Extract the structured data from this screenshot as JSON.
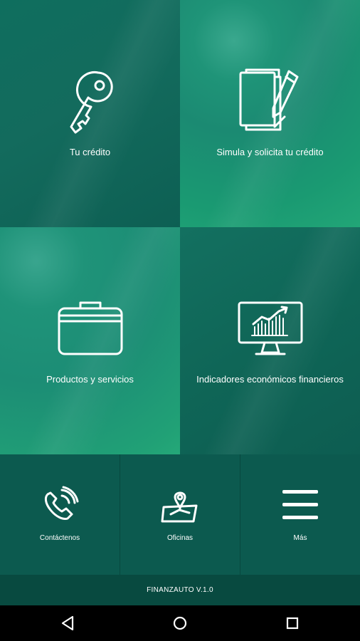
{
  "tiles": {
    "credit": {
      "label": "Tu crédito",
      "icon": "key-icon"
    },
    "simulate": {
      "label": "Simula y solicita tu crédito",
      "icon": "documents-pencil-icon"
    },
    "products": {
      "label": "Productos y servicios",
      "icon": "briefcase-icon"
    },
    "indicators": {
      "label": "Indicadores económicos financieros",
      "icon": "monitor-chart-icon"
    }
  },
  "shortcuts": {
    "contact": {
      "label": "Contáctenos",
      "icon": "phone-icon"
    },
    "offices": {
      "label": "Oficinas",
      "icon": "map-pin-icon"
    },
    "more": {
      "label": "Más",
      "icon": "menu-icon"
    }
  },
  "footer": {
    "version": "FINANZAUTO V.1.0"
  },
  "navbar": {
    "back": "back-icon",
    "home": "home-icon",
    "recents": "recents-icon"
  },
  "colors": {
    "primary_dark": "#0c5a4f",
    "primary": "#136b5d",
    "accent": "#22a677"
  }
}
